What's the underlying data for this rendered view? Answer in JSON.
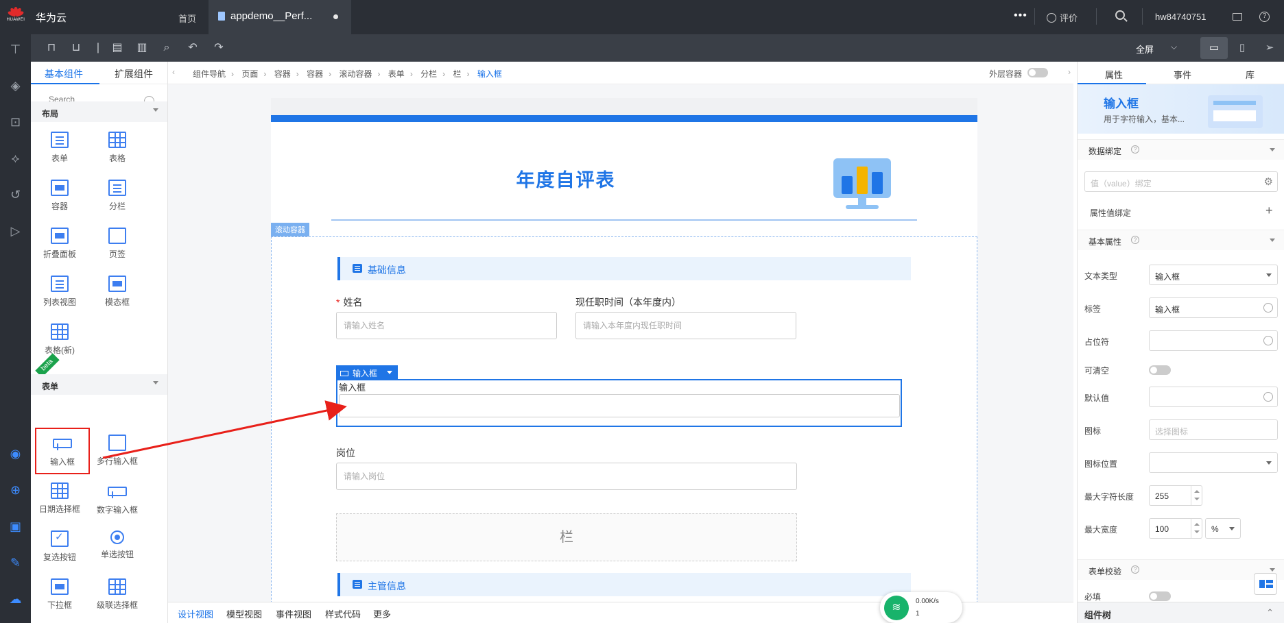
{
  "topbar": {
    "logo_brand": "HUAWEI",
    "cloud_name": "华为云",
    "home_link": "首页",
    "file_tab_title": "appdemo__Perf...",
    "feedback_label": "评价",
    "username": "hw84740751",
    "more_icon": "more-horizontal-icon"
  },
  "rail": {
    "icons": [
      "org-tree-icon",
      "layers-icon",
      "import-icon",
      "network-icon",
      "history-icon",
      "run-icon",
      "preview-eye-icon",
      "target-icon",
      "terminal-icon",
      "wrench-icon",
      "cloud-upload-icon"
    ]
  },
  "toolbar": {
    "fullscreen_label": "全屏",
    "icons": [
      "lock-icon",
      "unlock-icon",
      "divider",
      "save-icon",
      "save-as-icon",
      "preview-icon",
      "undo-icon",
      "redo-icon"
    ]
  },
  "components": {
    "tab_basic": "基本组件",
    "tab_extended": "扩展组件",
    "search_placeholder": "Search",
    "section_layout": "布局",
    "layout_items": [
      "表单",
      "表格",
      "容器",
      "分栏",
      "折叠面板",
      "页签",
      "列表视图",
      "模态框",
      "表格(新)"
    ],
    "beta_label": "beta",
    "section_form": "表单",
    "form_items": [
      "输入框",
      "多行输入框",
      "日期选择框",
      "数字输入框",
      "复选按钮",
      "单选按钮",
      "下拉框",
      "级联选择框"
    ]
  },
  "breadcrumb": {
    "items": [
      "组件导航",
      "页面",
      "容器",
      "容器",
      "滚动容器",
      "表单",
      "分栏",
      "栏"
    ],
    "current": "输入框",
    "outer_container_label": "外层容器"
  },
  "canvas": {
    "form_title": "年度自评表",
    "scroll_container_tag": "滚动容器",
    "section_basic_info": "基础信息",
    "field_name_label": "姓名",
    "field_name_placeholder": "请输入姓名",
    "field_tenure_label": "现任职时间（本年度内）",
    "field_tenure_placeholder": "请输入本年度内现任职时间",
    "selected_tag_label": "输入框",
    "selected_field_label": "输入框",
    "field_position_label": "岗位",
    "field_position_placeholder": "请输入岗位",
    "column_placeholder": "栏",
    "section_manager_info": "主管信息",
    "colors": {
      "accent": "#1f75e6",
      "bar_blue": "#1f75e6",
      "bar_yellow": "#f5b400",
      "highlight_red": "#e8201a"
    }
  },
  "bottom": {
    "tabs": [
      "设计视图",
      "模型视图",
      "事件视图",
      "样式代码",
      "更多"
    ],
    "active_tab": "设计视图",
    "net_speed": "0.00K/s",
    "net_count": "1"
  },
  "props": {
    "tab_attr": "属性",
    "tab_event": "事件",
    "tab_lib": "库",
    "comp_name": "输入框",
    "comp_desc": "用于字符输入，基本...",
    "section_data_binding": "数据绑定",
    "value_binding_placeholder": "值（value）绑定",
    "attr_value_binding": "属性值绑定",
    "section_basic_attrs": "基本属性",
    "text_type_label": "文本类型",
    "text_type_value": "输入框",
    "label_label": "标签",
    "label_value": "输入框",
    "placeholder_label": "占位符",
    "clearable_label": "可清空",
    "default_label": "默认值",
    "icon_label": "图标",
    "icon_placeholder": "选择图标",
    "icon_position_label": "图标位置",
    "max_chars_label": "最大字符长度",
    "max_chars_value": "255",
    "max_width_label": "最大宽度",
    "max_width_value": "100",
    "max_width_unit": "%",
    "section_validation": "表单校验",
    "required_label": "必填",
    "component_tree": "组件树"
  }
}
